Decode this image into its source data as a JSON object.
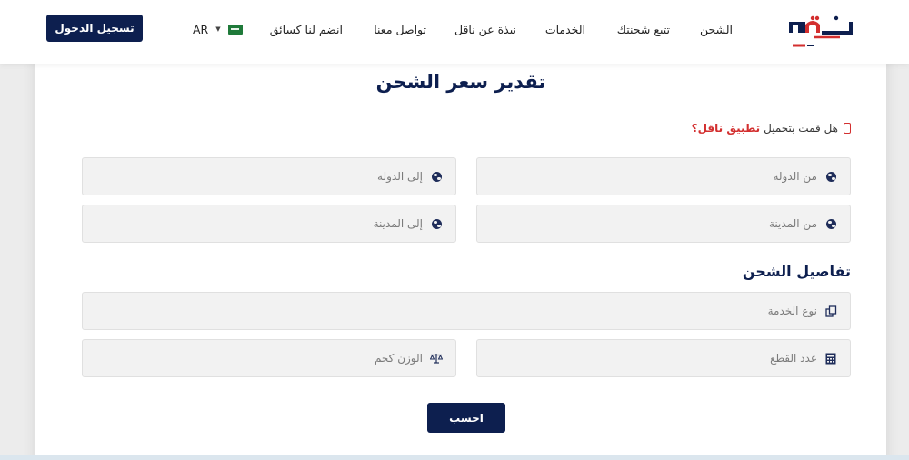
{
  "header": {
    "logo_text": "ناقل اكسبرس",
    "nav": [
      {
        "label": "الشحن"
      },
      {
        "label": "تتبع شحنتك"
      },
      {
        "label": "الخدمات"
      },
      {
        "label": "نبذة عن ناقل"
      },
      {
        "label": "تواصل معنا"
      },
      {
        "label": "انضم لنا كسائق"
      }
    ],
    "language": "AR",
    "login_label": "تسجيل الدخول"
  },
  "form": {
    "title": "تقدير سعر الشحن",
    "app_prompt": "هل قمت بتحميل",
    "app_link": "تطبيق ناقل؟",
    "from_country_placeholder": "من الدولة",
    "to_country_placeholder": "إلى الدولة",
    "from_city_placeholder": "من المدينة",
    "to_city_placeholder": "إلى المدينة",
    "details_title": "تفاصيل الشحن",
    "service_type_placeholder": "نوع الخدمة",
    "pieces_placeholder": "عدد القطع",
    "weight_placeholder": "الوزن كجم",
    "calculate_label": "احسب"
  },
  "colors": {
    "brand_navy": "#0d1f4f",
    "brand_red": "#d32f2f",
    "field_bg": "#f2f2f2"
  },
  "icons": {
    "country": "globe-icon",
    "city": "globe-icon",
    "service": "copy-icon",
    "pieces": "calculator-icon",
    "weight": "scale-icon",
    "app": "phone-icon"
  }
}
